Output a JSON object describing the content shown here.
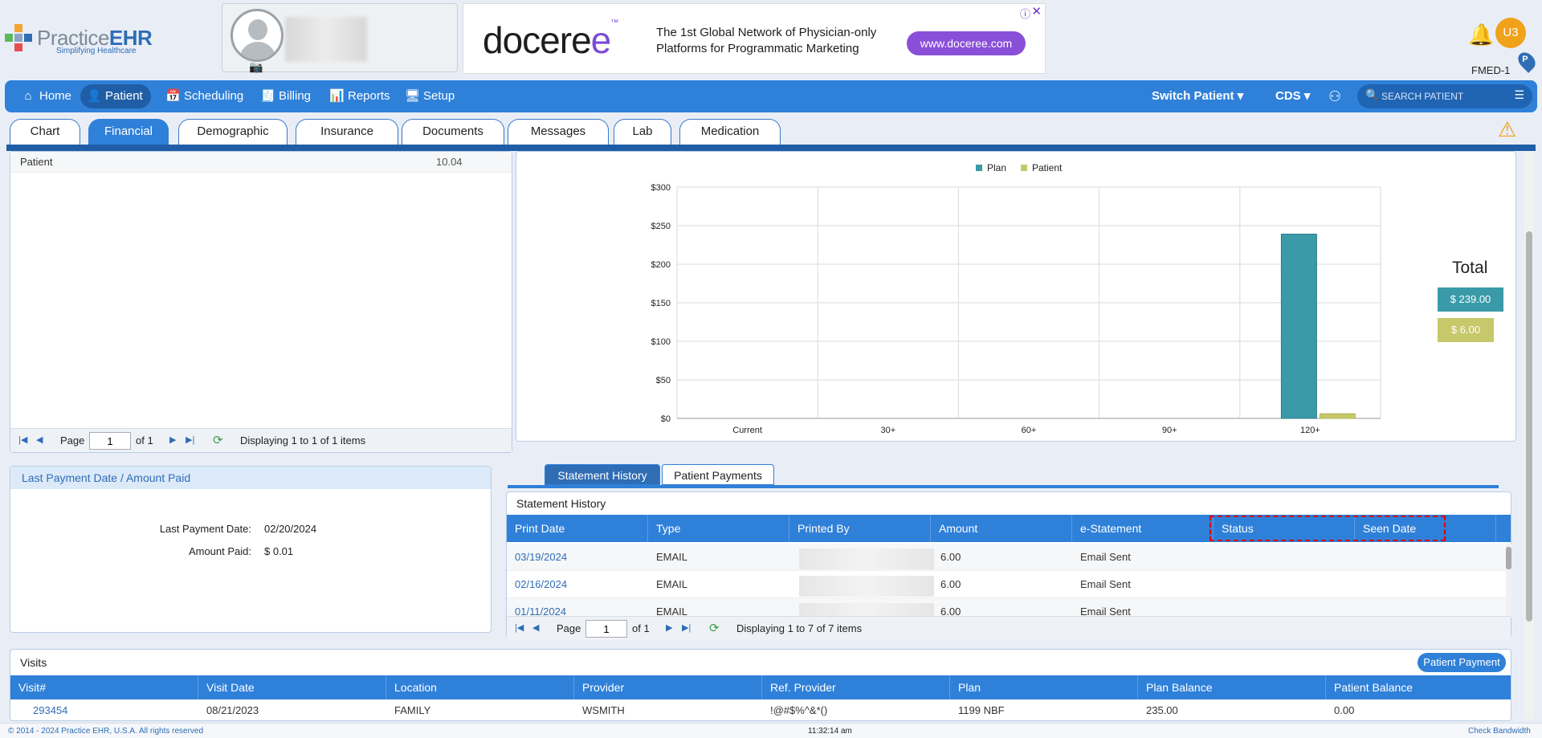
{
  "brand": {
    "name_light": "Practice",
    "name_bold": "EHR",
    "tagline": "Simplifying Healthcare"
  },
  "ad": {
    "brand_text": "doceree",
    "text_line1": "The 1st Global Network of Physician-only",
    "text_line2": "Platforms for Programmatic Marketing",
    "cta": "www.doceree.com",
    "info_icon": "ⓘ",
    "close_icon": "✕"
  },
  "user": {
    "initials": "U3",
    "facility": "FMED-1",
    "facility_pin": "P"
  },
  "nav": {
    "items": [
      {
        "label": "Home",
        "icon": "⌂"
      },
      {
        "label": "Patient",
        "icon": "👤"
      },
      {
        "label": "Scheduling",
        "icon": "📅"
      },
      {
        "label": "Billing",
        "icon": "🧾"
      },
      {
        "label": "Reports",
        "icon": "📊"
      },
      {
        "label": "Setup",
        "icon": "🖥"
      }
    ],
    "active": "Patient",
    "switch_patient": "Switch Patient",
    "cds": "CDS",
    "search_placeholder": "SEARCH PATIENT"
  },
  "patient_tabs": {
    "items": [
      "Chart",
      "Financial",
      "Demographic",
      "Insurance",
      "Documents",
      "Messages",
      "Lab",
      "Medication"
    ],
    "active": "Financial"
  },
  "aging_table": {
    "row_label": "Patient",
    "row_value": "10.04",
    "pager": {
      "page_label": "Page",
      "page": "1",
      "of": "of 1",
      "status": "Displaying 1 to 1 of 1 items"
    }
  },
  "chart_data": {
    "type": "bar",
    "categories": [
      "Current",
      "30+",
      "60+",
      "90+",
      "120+"
    ],
    "series": [
      {
        "name": "Plan",
        "values": [
          0,
          0,
          0,
          0,
          239.0
        ]
      },
      {
        "name": "Patient",
        "values": [
          0,
          0,
          0,
          0,
          6.0
        ]
      }
    ],
    "ylim": [
      0,
      300
    ],
    "yticks": [
      "$0",
      "$50",
      "$100",
      "$150",
      "$200",
      "$250",
      "$300"
    ],
    "ytick_values": [
      0,
      50,
      100,
      150,
      200,
      250,
      300
    ],
    "legend_position": "top-center",
    "grid": true,
    "colors": {
      "Plan": "#3a9aa8",
      "Patient": "#c6c86a"
    }
  },
  "totals": {
    "label": "Total",
    "plan": "$ 239.00",
    "patient": "$ 6.00"
  },
  "last_payment": {
    "title": "Last Payment Date / Amount Paid",
    "date_label": "Last Payment Date:",
    "date_value": "02/20/2024",
    "amount_label": "Amount Paid:",
    "amount_value": "$ 0.01"
  },
  "statement_tabs": {
    "items": [
      "Statement History",
      "Patient Payments"
    ],
    "active": "Statement History"
  },
  "statement_history": {
    "title": "Statement History",
    "columns": [
      "Print Date",
      "Type",
      "Printed By",
      "Amount",
      "e-Statement",
      "Status",
      "Seen Date"
    ],
    "rows": [
      {
        "print_date": "03/19/2024",
        "type": "EMAIL",
        "amount": "6.00",
        "e_statement": "Email Sent"
      },
      {
        "print_date": "02/16/2024",
        "type": "EMAIL",
        "amount": "6.00",
        "e_statement": "Email Sent"
      },
      {
        "print_date": "01/11/2024",
        "type": "EMAIL",
        "amount": "6.00",
        "e_statement": "Email Sent"
      }
    ],
    "pager": {
      "page_label": "Page",
      "page": "1",
      "of": "of 1",
      "status": "Displaying 1 to 7 of 7 items"
    }
  },
  "visits": {
    "title": "Visits",
    "button": "Patient Payment",
    "columns": [
      "Visit#",
      "Visit Date",
      "Location",
      "Provider",
      "Ref. Provider",
      "Plan",
      "Plan Balance",
      "Patient Balance"
    ],
    "rows": [
      {
        "visit": "293454",
        "date": "08/21/2023",
        "location": "FAMILY",
        "provider": "WSMITH",
        "ref_provider": "!@#$%^&*()",
        "plan": "1199 NBF",
        "plan_balance": "235.00",
        "patient_balance": "0.00"
      }
    ]
  },
  "footer": {
    "copyright": "© 2014 - 2024 Practice EHR, U.S.A. All rights reserved",
    "time": "11:32:14 am",
    "bandwidth": "Check Bandwidth"
  }
}
